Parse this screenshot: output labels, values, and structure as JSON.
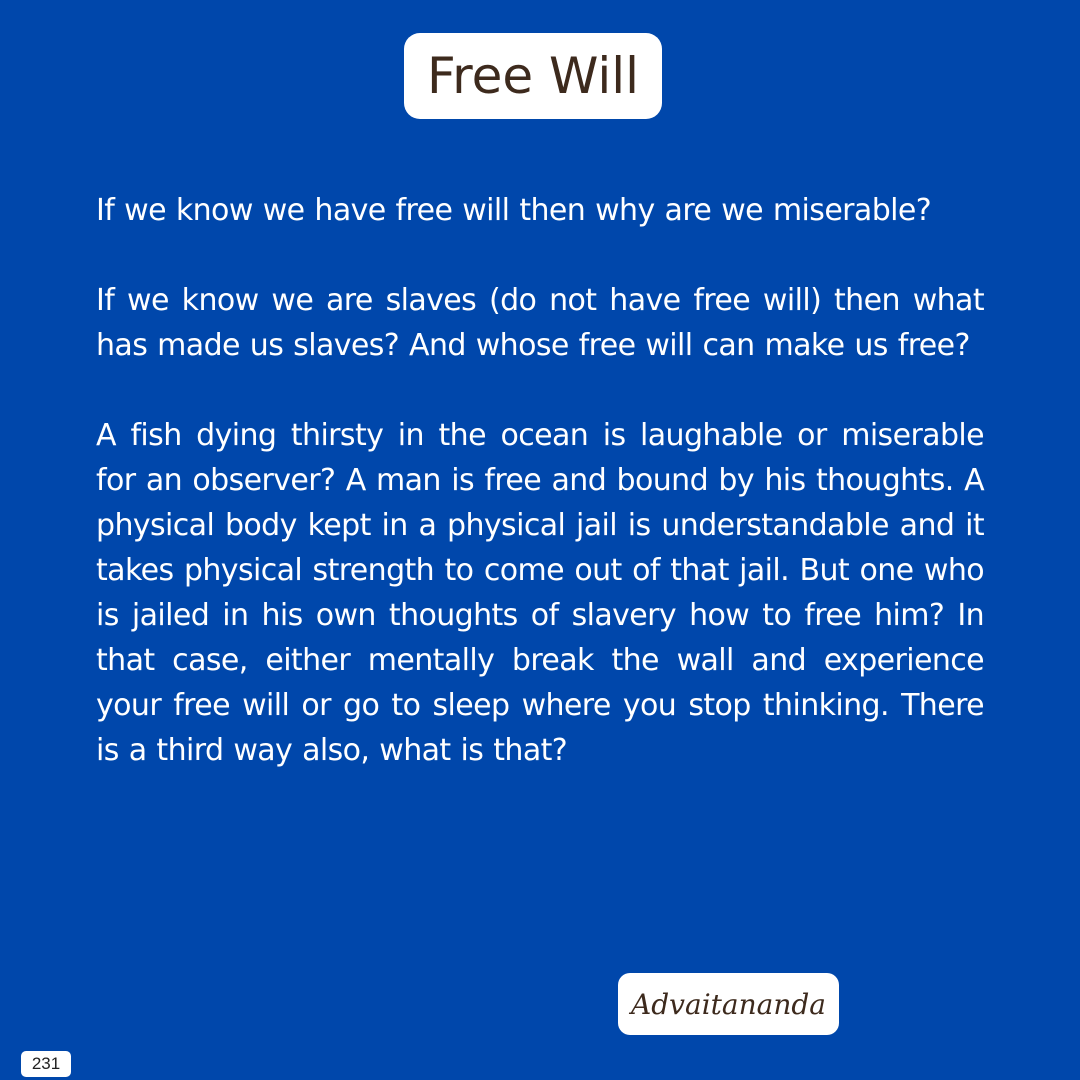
{
  "title": "Free Will",
  "paragraphs": [
    "If we know we have free will then why are we miserable?",
    "If we know we are slaves (do not have free will) then what has made us slaves? And whose free will can make us free?",
    "A fish dying thirsty in the ocean is laughable or miserable for an observer? A man is free and bound by his thoughts. A physical body kept in a physical jail is understandable and it takes physical strength to come out of that jail. But one who is jailed in his own thoughts of slavery how to free him? In that case, either mentally break the wall and experience your free will or go to sleep where you stop thinking. There is a third way also, what is that?"
  ],
  "signature": "Advaitananda",
  "page_number": "231",
  "colors": {
    "background": "#0047ab",
    "box": "#ffffff",
    "title_text": "#3d2a1d",
    "body_text": "#ffffff"
  }
}
